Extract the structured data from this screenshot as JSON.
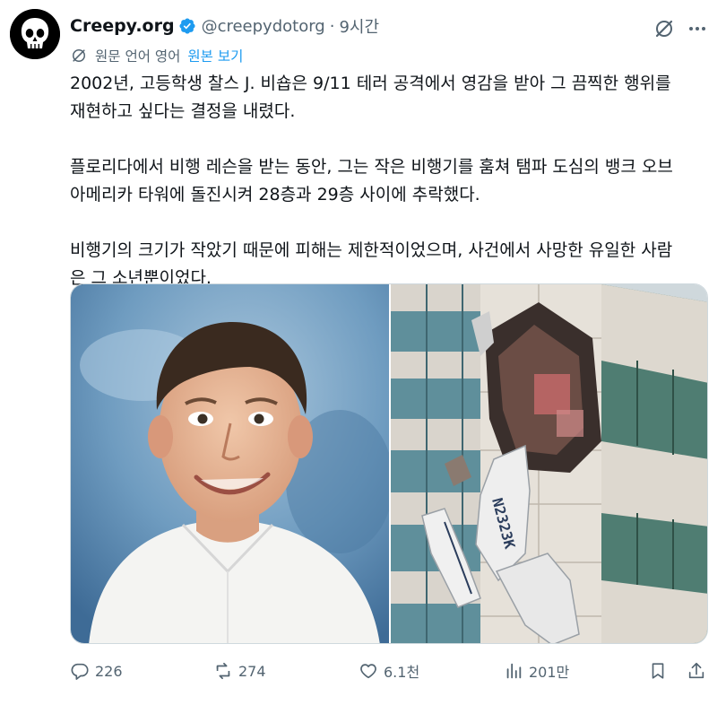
{
  "author": {
    "name": "Creepy.org",
    "handle": "@creepydotorg",
    "separator": "·",
    "time": "9시간",
    "avatar_icon": "skull-icon"
  },
  "header_actions": {
    "grok_icon": "grok-icon",
    "more_icon": "more-icon"
  },
  "translation": {
    "label": "원문 언어 영어",
    "link": "원본 보기"
  },
  "tweet": {
    "lines": [
      "2002년, 고등학생 찰스 J. 비숍은 9/11 테러 공격에서 영감을 받아 그 끔찍한 행위를",
      "재현하고 싶다는 결정을 내렸다.",
      "",
      "플로리다에서 비행 레슨을 받는 동안, 그는 작은 비행기를 훔쳐 탬파 도심의 뱅크 오브",
      "아메리카 타워에 돌진시켜 28층과 29층 사이에 추락했다.",
      "",
      "비행기의 크기가 작았기 때문에 피해는 제한적이었으며, 사건에서 사망한 유일한 사람",
      "은 그 소년뿐이었다."
    ]
  },
  "media": {
    "left_image": "teen-portrait-photo",
    "right_image": "plane-crash-building-photo",
    "plane_registration": "N2323K"
  },
  "metrics": {
    "replies": "226",
    "reposts": "274",
    "likes": "6.1천",
    "views": "201만"
  },
  "colors": {
    "accent": "#1d9bf0",
    "muted": "#536471",
    "text": "#0f1419"
  }
}
